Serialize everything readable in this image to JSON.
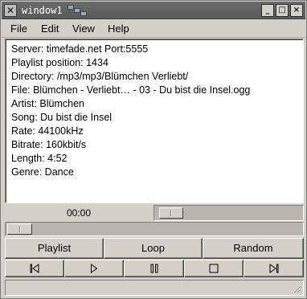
{
  "window": {
    "title": "window1",
    "controls": {
      "minimize": "_",
      "maximize": "□",
      "close": "×"
    }
  },
  "menu": {
    "file": "File",
    "edit": "Edit",
    "view": "View",
    "help": "Help"
  },
  "info": {
    "server": "Server: timefade.net Port:5555",
    "playlist_position": "Playlist position: 1434",
    "directory": "Directory: /mp3/mp3/Blümchen Verliebt/",
    "file": "File: Blümchen - Verliebt… - 03 - Du bist die Insel.ogg",
    "artist": "Artist: Blümchen",
    "song": "Song: Du bist die Insel",
    "rate": "Rate: 44100kHz",
    "bitrate": "Bitrate: 160kbit/s",
    "length": "Length: 4:52",
    "genre": "Genre: Dance"
  },
  "playback": {
    "time": "00:00",
    "volume_fraction": 0.0,
    "position_fraction": 0.0
  },
  "buttons": {
    "playlist": "Playlist",
    "loop": "Loop",
    "random": "Random"
  },
  "transport": [
    "previous-icon",
    "play-icon",
    "pause-icon",
    "stop-icon",
    "next-icon"
  ],
  "statusbar": {
    "text": ""
  }
}
